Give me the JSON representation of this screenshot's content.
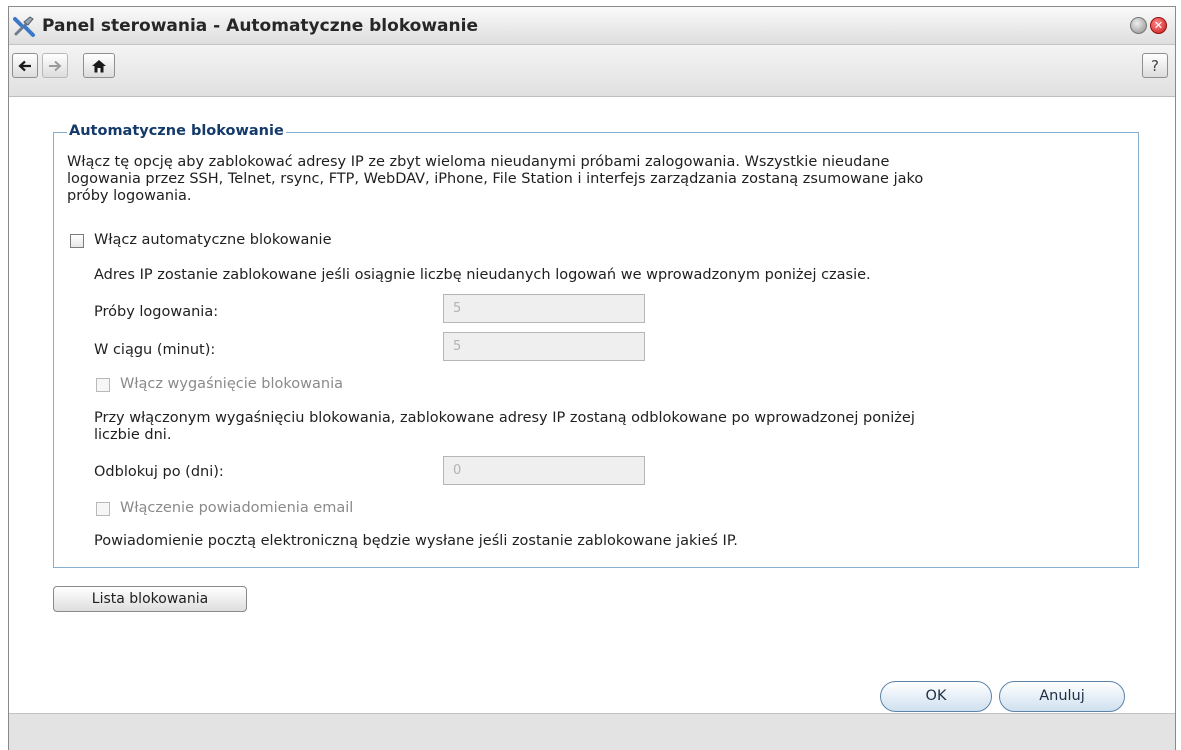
{
  "window": {
    "title": "Panel sterowania - Automatyczne blokowanie"
  },
  "toolbar": {
    "back_icon": "arrow-left-icon",
    "forward_icon": "arrow-right-icon",
    "home_icon": "home-icon",
    "help_label": "?"
  },
  "section": {
    "legend": "Automatyczne blokowanie",
    "description_lines": [
      "Włącz tę opcję aby zablokować adresy IP ze zbyt wieloma nieudanymi próbami zalogowania. Wszystkie nieudane",
      "logowania przez SSH, Telnet, rsync, FTP, WebDAV, iPhone, File Station i interfejs zarządzania zostaną zsumowane jako",
      "próby logowania."
    ],
    "enable_checkbox": {
      "label": "Włącz automatyczne blokowanie",
      "checked": false
    },
    "block_info": "Adres IP zostanie zablokowane jeśli osiągnie liczbę nieudanych logowań we wprowadzonym poniżej czasie.",
    "attempts": {
      "label": "Próby logowania:",
      "value": "5"
    },
    "within": {
      "label": "W ciągu (minut):",
      "value": "5"
    },
    "expiry_checkbox": {
      "label": "Włącz wygaśnięcie blokowania",
      "checked": false
    },
    "expiry_info_lines": [
      "Przy włączonym wygaśnięciu blokowania, zablokowane adresy IP zostaną odblokowane po wprowadzonej poniżej",
      "liczbie dni."
    ],
    "unblock_days": {
      "label": "Odblokuj po (dni):",
      "value": "0"
    },
    "email_checkbox": {
      "label": "Włączenie powiadomienia email",
      "checked": false
    },
    "email_info": "Powiadomienie pocztą elektroniczną będzie wysłane jeśli zostanie zablokowane jakieś IP."
  },
  "buttons": {
    "block_list": "Lista blokowania",
    "ok": "OK",
    "cancel": "Anuluj"
  },
  "colors": {
    "legend": "#133a6a",
    "fieldset_border": "#86aecf",
    "close_button": "#c71818"
  }
}
